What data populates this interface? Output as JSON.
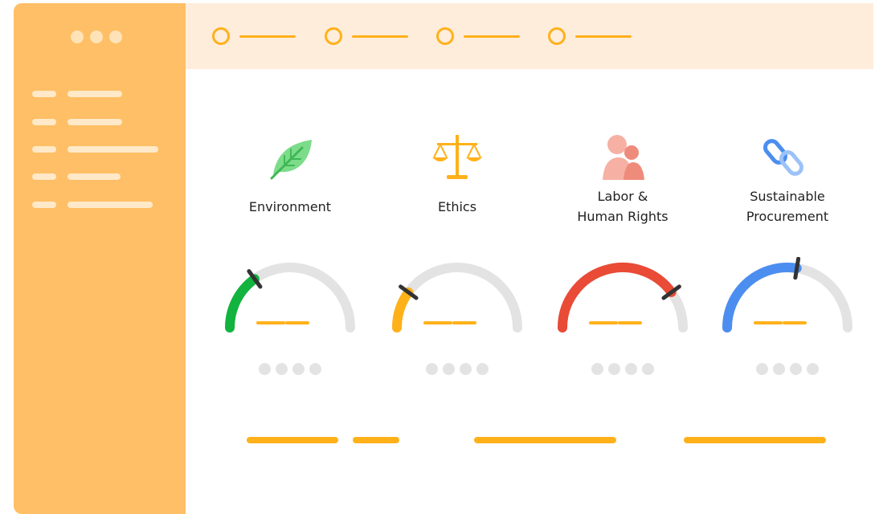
{
  "window": {
    "controls": [
      "window-dot-1",
      "window-dot-2",
      "window-dot-3"
    ]
  },
  "sidebar": {
    "items": [
      {
        "icon": "menu-item-placeholder"
      },
      {
        "icon": "menu-item-placeholder"
      },
      {
        "icon": "menu-item-placeholder"
      },
      {
        "icon": "menu-item-placeholder"
      },
      {
        "icon": "menu-item-placeholder"
      }
    ]
  },
  "stepper": {
    "steps": 4,
    "accent": "#FFB11A"
  },
  "categories": [
    {
      "label_lines": [
        "Environment"
      ],
      "icon": "leaf-icon",
      "gauge_color": "#12B33E",
      "gauge_level": 0.3
    },
    {
      "label_lines": [
        "Ethics"
      ],
      "icon": "scales-icon",
      "gauge_color": "#FFB11A",
      "gauge_level": 0.2
    },
    {
      "label_lines": [
        "Labor &",
        "Human Rights"
      ],
      "icon": "people-icon",
      "gauge_color": "#E94B37",
      "gauge_level": 0.8
    },
    {
      "label_lines": [
        "Sustainable",
        "Procurement"
      ],
      "icon": "chain-link-icon",
      "gauge_color": "#4C8EF0",
      "gauge_level": 0.55
    }
  ],
  "colors": {
    "sidebar": "#FFBF66",
    "topbar": "#FFEDDC",
    "accent": "#FFB11A",
    "gauge_track": "#E3E3E3",
    "needle": "#333333"
  }
}
